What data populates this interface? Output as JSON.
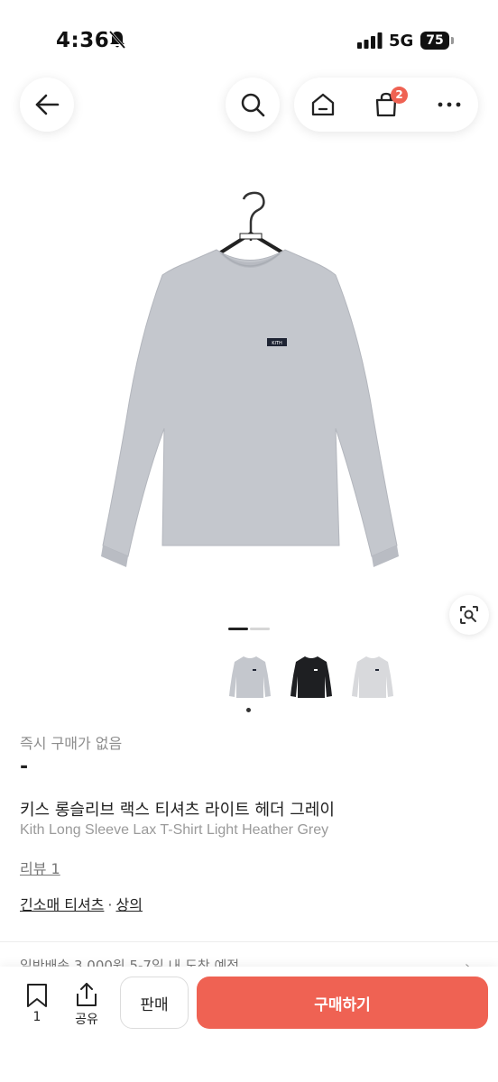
{
  "status_bar": {
    "time": "4:36",
    "network": "5G",
    "battery": "75"
  },
  "header": {
    "cart_count": "2"
  },
  "icons": {
    "back": "arrow-left-icon",
    "search": "search-icon",
    "home": "home-icon",
    "cart": "shopping-bag-icon",
    "more": "more-dots-icon",
    "lens": "image-search-icon",
    "bookmark": "bookmark-icon",
    "share": "share-icon"
  },
  "product": {
    "instant_status": "즉시 구매가 없음",
    "price": "-",
    "title_ko": "키스 롱슬리브 랙스 티셔츠 라이트 헤더 그레이",
    "title_en": "Kith Long Sleeve Lax T-Shirt Light Heather Grey",
    "review_link": "리뷰 1",
    "categories": [
      "긴소매 티셔츠",
      "상의"
    ],
    "category_separator": "·",
    "shipping": "일반배송 3,000원 5-7일 내 도착 예정"
  },
  "bottom_bar": {
    "bookmark_count": "1",
    "share_label": "공유",
    "sell_label": "판매",
    "buy_label": "구매하기"
  },
  "colors": {
    "accent": "#ef6253",
    "shirt_grey": "#c4c7cd",
    "shirt_black": "#1e1f22",
    "shirt_light": "#d8d9dc"
  }
}
